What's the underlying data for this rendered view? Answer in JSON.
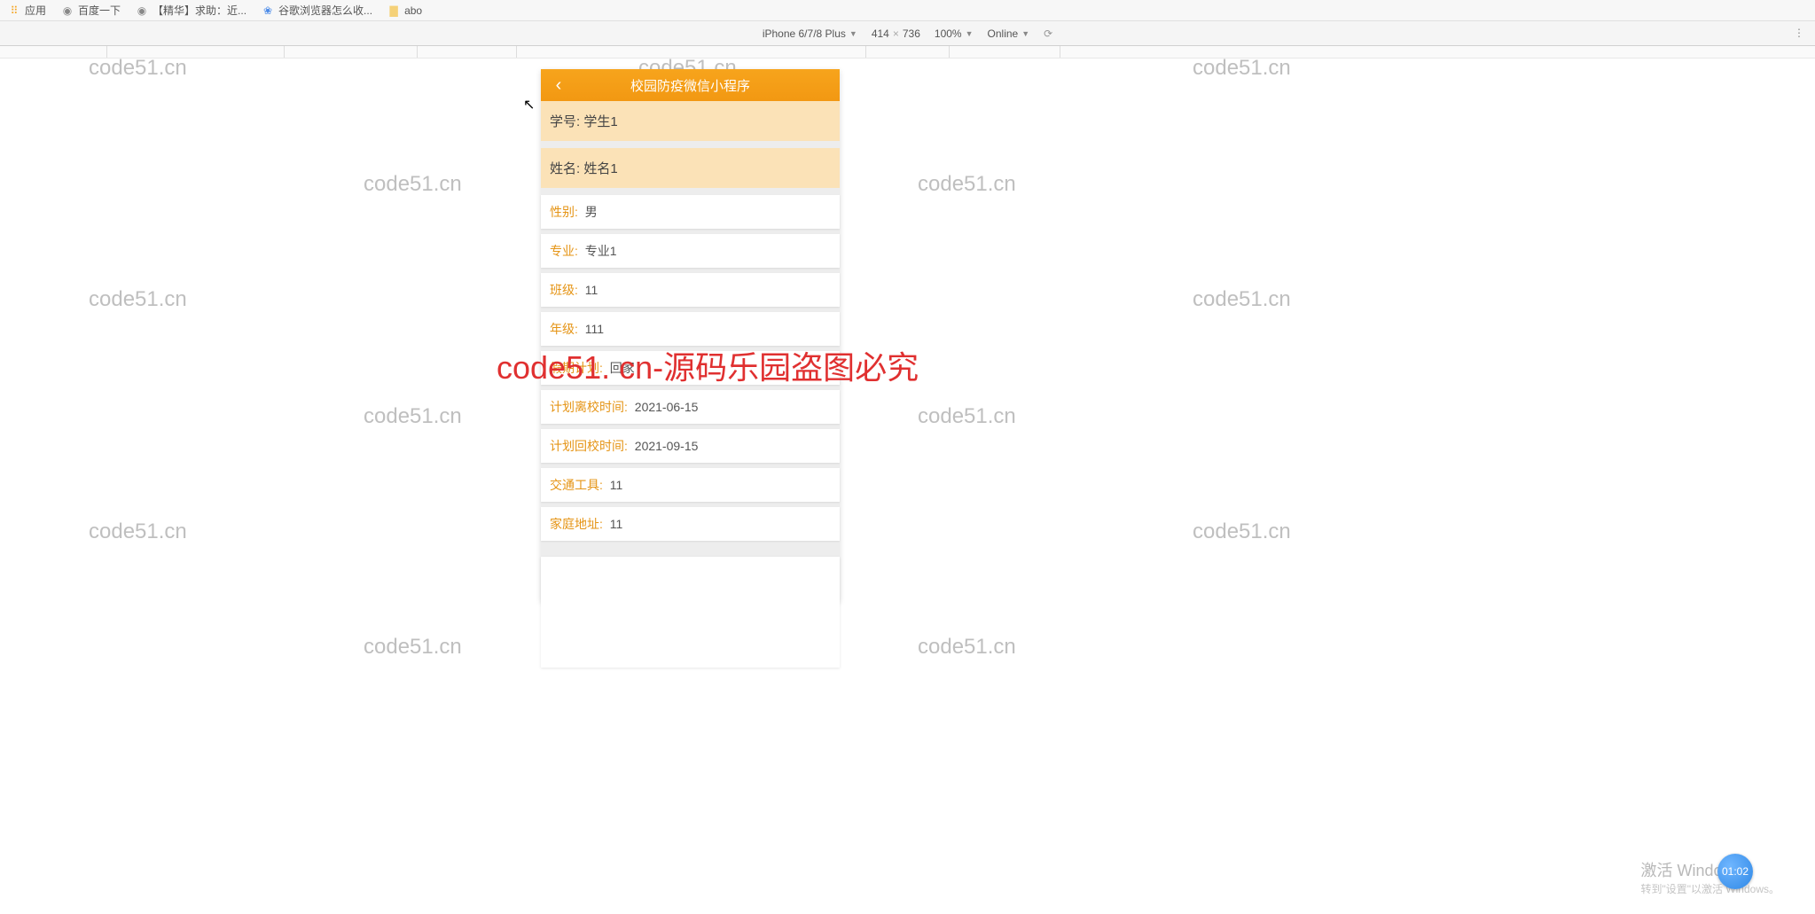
{
  "bookmarks": {
    "apps": "应用",
    "baidu": "百度一下",
    "jinghua": "【精华】求助：近...",
    "guge": "谷歌浏览器怎么收...",
    "abo": "abo"
  },
  "devtools": {
    "device": "iPhone 6/7/8 Plus",
    "width": "414",
    "height": "736",
    "zoom": "100%",
    "network": "Online"
  },
  "watermark_text": "code51.cn",
  "overlay_red": "code51. cn-源码乐园盗图必究",
  "app": {
    "title": "校园防疫微信小程序",
    "student_id_label": "学号:",
    "student_id_value": "学生1",
    "name_label": "姓名:",
    "name_value": "姓名1",
    "fields": [
      {
        "label": "性别:",
        "value": "男"
      },
      {
        "label": "专业:",
        "value": "专业1"
      },
      {
        "label": "班级:",
        "value": "11"
      },
      {
        "label": "年级:",
        "value": "111"
      },
      {
        "label": "假期计划:",
        "value": "回家"
      },
      {
        "label": "计划离校时间:",
        "value": "2021-06-15"
      },
      {
        "label": "计划回校时间:",
        "value": "2021-09-15"
      },
      {
        "label": "交通工具:",
        "value": "11"
      },
      {
        "label": "家庭地址:",
        "value": "11"
      }
    ]
  },
  "windows_activate": {
    "line1": "激活 Windows",
    "line2": "转到\"设置\"以激活 Windows。"
  },
  "time_badge": "01:02"
}
